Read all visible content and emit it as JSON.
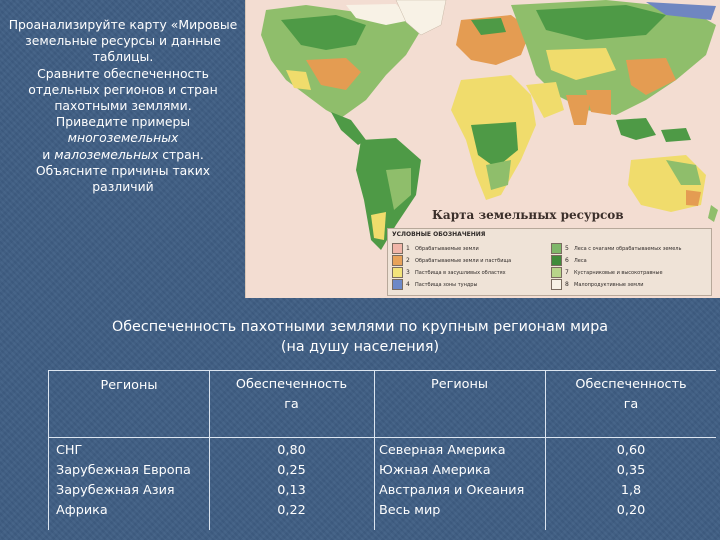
{
  "task": {
    "lines": [
      "Проанализируйте карту «Мировые",
      "земельные ресурсы и данные",
      "таблицы.",
      "Сравните обеспеченность",
      "отдельных регионов и стран",
      "пахотными землями.",
      "Приведите примеры"
    ],
    "it1": "многоземельных",
    "pre2": "и ",
    "it2": "малоземельных",
    "post2": " стран.",
    "line_a": "Объясните причины таких",
    "line_b": "различий"
  },
  "map": {
    "title": "Карта земельных ресурсов",
    "legend_heading": "УСЛОВНЫЕ ОБОЗНАЧЕНИЯ",
    "legend_items": [
      {
        "num": "1",
        "color": "#f0b5a8",
        "text": "Обрабатываемые земли"
      },
      {
        "num": "2",
        "color": "#e8a35a",
        "text": "Обрабатываемые земли и пастбища"
      },
      {
        "num": "3",
        "color": "#f3e37a",
        "text": "Пастбища в засушливых областях"
      },
      {
        "num": "4",
        "color": "#6d88c7",
        "text": "Пастбища зоны тундры"
      },
      {
        "num": "5",
        "color": "#7fb76a",
        "text": "Леса с очагами обрабатываемых земель"
      },
      {
        "num": "6",
        "color": "#3f8b3a",
        "text": "Леса"
      },
      {
        "num": "7",
        "color": "#b8d58a",
        "text": "Кустарниковые и высокотравные"
      },
      {
        "num": "8",
        "color": "#f8f2e6",
        "text": "Малопродуктивные земли"
      }
    ],
    "colors": {
      "sea": "#f3ddd2",
      "forest": "#4e9a46",
      "mixed": "#8fbe6b",
      "dry": "#f0dc6c",
      "crop": "#e49c52",
      "tundra": "#6f86c1"
    }
  },
  "table_title_line1": "Обеспеченность пахотными землями по крупным регионам мира",
  "table_title_line2": "(на душу населения)",
  "table": {
    "headers": {
      "col1": "Регионы",
      "col2a": "Обеспеченность",
      "col2b": "га",
      "col3": "Регионы",
      "col4a": "Обеспеченность",
      "col4b": "га"
    },
    "left": [
      {
        "region": "СНГ",
        "value": "0,80"
      },
      {
        "region": "Зарубежная Европа",
        "value": "0,25"
      },
      {
        "region": "Зарубежная Азия",
        "value": "0,13"
      },
      {
        "region": "Африка",
        "value": "0,22"
      }
    ],
    "right": [
      {
        "region": "Северная Америка",
        "value": "0,60"
      },
      {
        "region": "Южная Америка",
        "value": "0,35"
      },
      {
        "region": "Австралия и Океания",
        "value": "1,8"
      },
      {
        "region": "Весь мир",
        "value": "0,20"
      }
    ]
  }
}
